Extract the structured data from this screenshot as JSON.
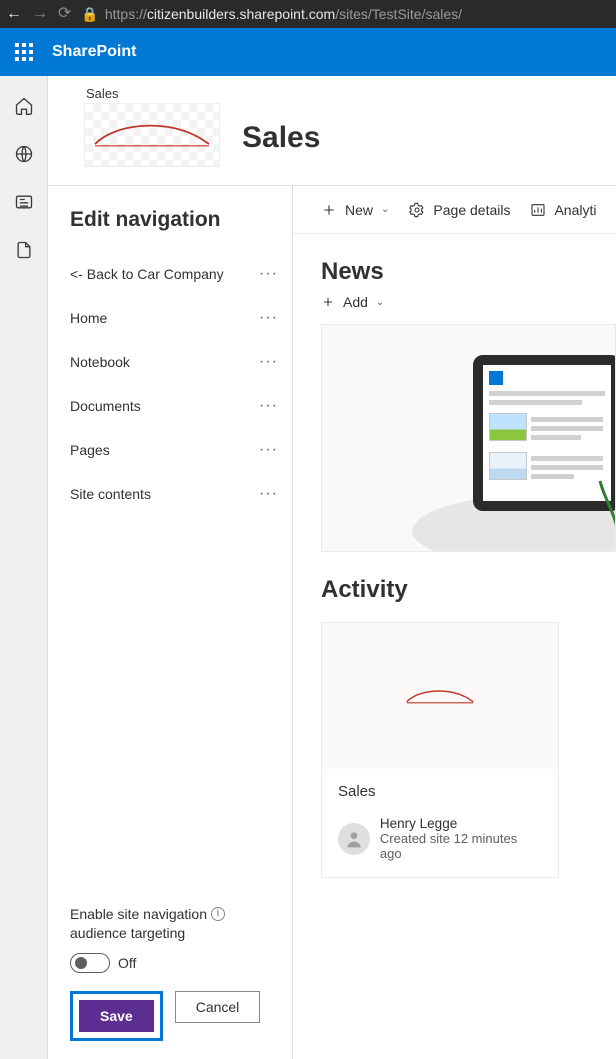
{
  "browser": {
    "url_prefix": "https://",
    "url_host": "citizenbuilders.sharepoint.com",
    "url_path": "/sites/TestSite/sales/"
  },
  "suite": {
    "brand": "SharePoint"
  },
  "site": {
    "small_label": "Sales",
    "title": "Sales"
  },
  "edit_nav": {
    "heading": "Edit navigation",
    "items": [
      {
        "label": "<- Back to Car Company"
      },
      {
        "label": "Home"
      },
      {
        "label": "Notebook"
      },
      {
        "label": "Documents"
      },
      {
        "label": "Pages"
      },
      {
        "label": "Site contents"
      }
    ],
    "audience_label_line1": "Enable site navigation",
    "audience_label_line2": "audience targeting",
    "toggle_state": "Off",
    "save_label": "Save",
    "cancel_label": "Cancel"
  },
  "cmdbar": {
    "new": "New",
    "page_details": "Page details",
    "analytics": "Analyti"
  },
  "news": {
    "heading": "News",
    "add": "Add"
  },
  "activity": {
    "heading": "Activity",
    "card": {
      "title": "Sales",
      "author": "Henry Legge",
      "subtitle": "Created site 12 minutes ago"
    }
  }
}
